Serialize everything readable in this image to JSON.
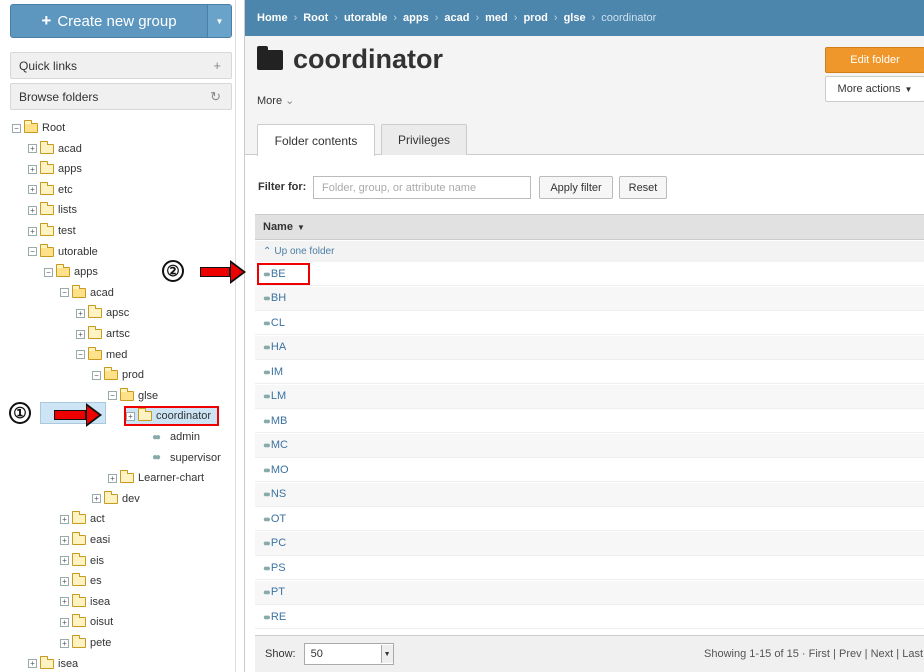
{
  "sidebar": {
    "create_label": "Create new group",
    "create_icon": "plus-icon",
    "quick_links": "Quick links",
    "browse_folders": "Browse folders",
    "tree": [
      {
        "label": "Root",
        "icon": "folder-open",
        "toggle": "minus"
      },
      {
        "label": "acad",
        "icon": "folder",
        "toggle": "plus"
      },
      {
        "label": "apps",
        "icon": "folder",
        "toggle": "plus"
      },
      {
        "label": "etc",
        "icon": "folder",
        "toggle": "plus"
      },
      {
        "label": "lists",
        "icon": "folder",
        "toggle": "plus"
      },
      {
        "label": "test",
        "icon": "folder",
        "toggle": "plus"
      },
      {
        "label": "utorable",
        "icon": "folder-open",
        "toggle": "minus"
      },
      {
        "label": "apps",
        "icon": "folder-open",
        "toggle": "minus"
      },
      {
        "label": "acad",
        "icon": "folder-open",
        "toggle": "minus"
      },
      {
        "label": "apsc",
        "icon": "folder",
        "toggle": "plus"
      },
      {
        "label": "artsc",
        "icon": "folder",
        "toggle": "plus"
      },
      {
        "label": "med",
        "icon": "folder-open",
        "toggle": "minus"
      },
      {
        "label": "prod",
        "icon": "folder-open",
        "toggle": "minus"
      },
      {
        "label": "glse",
        "icon": "folder-open",
        "toggle": "minus"
      },
      {
        "label": "coordinator",
        "icon": "folder",
        "toggle": "plus",
        "selected": true
      },
      {
        "label": "admin",
        "icon": "group"
      },
      {
        "label": "supervisor",
        "icon": "group"
      },
      {
        "label": "Learner-chart",
        "icon": "folder",
        "toggle": "plus"
      },
      {
        "label": "dev",
        "icon": "folder",
        "toggle": "plus"
      },
      {
        "label": "act",
        "icon": "folder",
        "toggle": "plus"
      },
      {
        "label": "easi",
        "icon": "folder",
        "toggle": "plus"
      },
      {
        "label": "eis",
        "icon": "folder",
        "toggle": "plus"
      },
      {
        "label": "es",
        "icon": "folder",
        "toggle": "plus"
      },
      {
        "label": "isea",
        "icon": "folder",
        "toggle": "plus"
      },
      {
        "label": "oisut",
        "icon": "folder",
        "toggle": "plus"
      },
      {
        "label": "pete",
        "icon": "folder",
        "toggle": "plus"
      },
      {
        "label": "isea",
        "icon": "folder",
        "toggle": "plus"
      }
    ]
  },
  "annotations": {
    "one": "①",
    "two": "②"
  },
  "breadcrumb": {
    "items": [
      "Home",
      "Root",
      "utorable",
      "apps",
      "acad",
      "med",
      "prod",
      "glse"
    ],
    "current": "coordinator"
  },
  "main": {
    "title": "coordinator",
    "more": "More",
    "edit_folder": "Edit folder",
    "more_actions": "More actions",
    "tabs": [
      "Folder contents",
      "Privileges"
    ],
    "filter_label": "Filter for:",
    "filter_placeholder": "Folder, group, or attribute name",
    "apply_filter": "Apply filter",
    "reset": "Reset",
    "col_name": "Name",
    "up_one": "Up one folder",
    "groups": [
      "BE",
      "BH",
      "CL",
      "HA",
      "IM",
      "LM",
      "MB",
      "MC",
      "MO",
      "NS",
      "OT",
      "PC",
      "PS",
      "PT",
      "RE"
    ],
    "show_label": "Show:",
    "show_value": "50",
    "showing": "Showing 1-15 of 15 ·",
    "pager": [
      "First",
      "Prev",
      "Next",
      "Last"
    ]
  },
  "colors": {
    "accent": "#4c86ad",
    "orange": "#f0972b",
    "highlight": "#ee0000"
  }
}
